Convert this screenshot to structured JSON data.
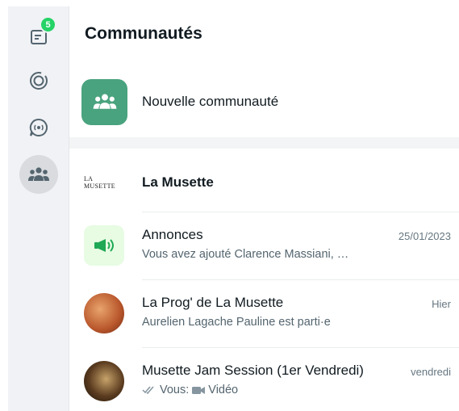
{
  "sidebar": {
    "items": [
      {
        "icon": "chats-icon",
        "badge": "5"
      },
      {
        "icon": "status-icon"
      },
      {
        "icon": "channels-icon"
      },
      {
        "icon": "communities-icon",
        "active": true
      }
    ]
  },
  "header": {
    "title": "Communautés"
  },
  "new_community": {
    "label": "Nouvelle communauté"
  },
  "community": {
    "logo_text": "LA MUSETTE",
    "name": "La Musette"
  },
  "chats": [
    {
      "name": "Annonces",
      "time": "25/01/2023",
      "preview": "Vous avez ajouté Clarence Massiani, …"
    },
    {
      "name": "La Prog' de La Musette",
      "time": "Hier",
      "preview": "Aurelien Lagache Pauline est parti·e"
    },
    {
      "name": "Musette Jam Session (1er Vendredi)",
      "time": "vendredi",
      "preview_prefix": "Vous:",
      "preview": "Vidéo"
    }
  ],
  "colors": {
    "accent": "#25d366",
    "tile": "#49a37e",
    "announce_bg": "#e7fce3",
    "announce_icon": "#1fa855"
  }
}
